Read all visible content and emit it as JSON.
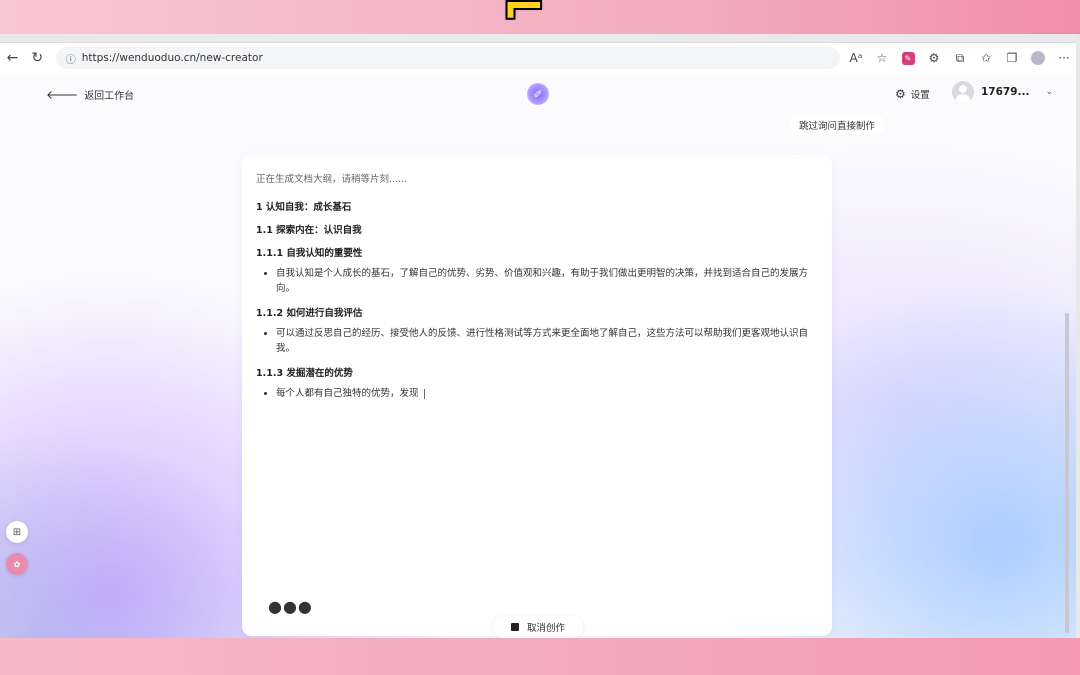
{
  "browser": {
    "url": "https://wenduoduo.cn/new-creator"
  },
  "header": {
    "back_label": "返回工作台",
    "settings_label": "设置",
    "user_name": "17679..."
  },
  "skip_button": "跳过询问直接制作",
  "card": {
    "status": "正在生成文档大纲，请稍等片刻......",
    "h1": "1 认知自我：成长基石",
    "h2": "1.1 探索内在：认识自我",
    "sections": [
      {
        "title": "1.1.1 自我认知的重要性",
        "bullet": "自我认知是个人成长的基石，了解自己的优势、劣势、价值观和兴趣，有助于我们做出更明智的决策，并找到适合自己的发展方向。"
      },
      {
        "title": "1.1.2 如何进行自我评估",
        "bullet": "可以通过反思自己的经历、接受他人的反馈、进行性格测试等方式来更全面地了解自己，这些方法可以帮助我们更客观地认识自我。"
      },
      {
        "title": "1.1.3 发掘潜在的优势",
        "bullet": "每个人都有自己独特的优势，发现"
      }
    ],
    "loading_dots": "●●●"
  },
  "cancel_button": "取消创作",
  "icons": {
    "back": "arrow-left-icon",
    "settings": "gear-icon",
    "logo": "ai-logo-icon",
    "chevron": "chevron-down-icon"
  }
}
